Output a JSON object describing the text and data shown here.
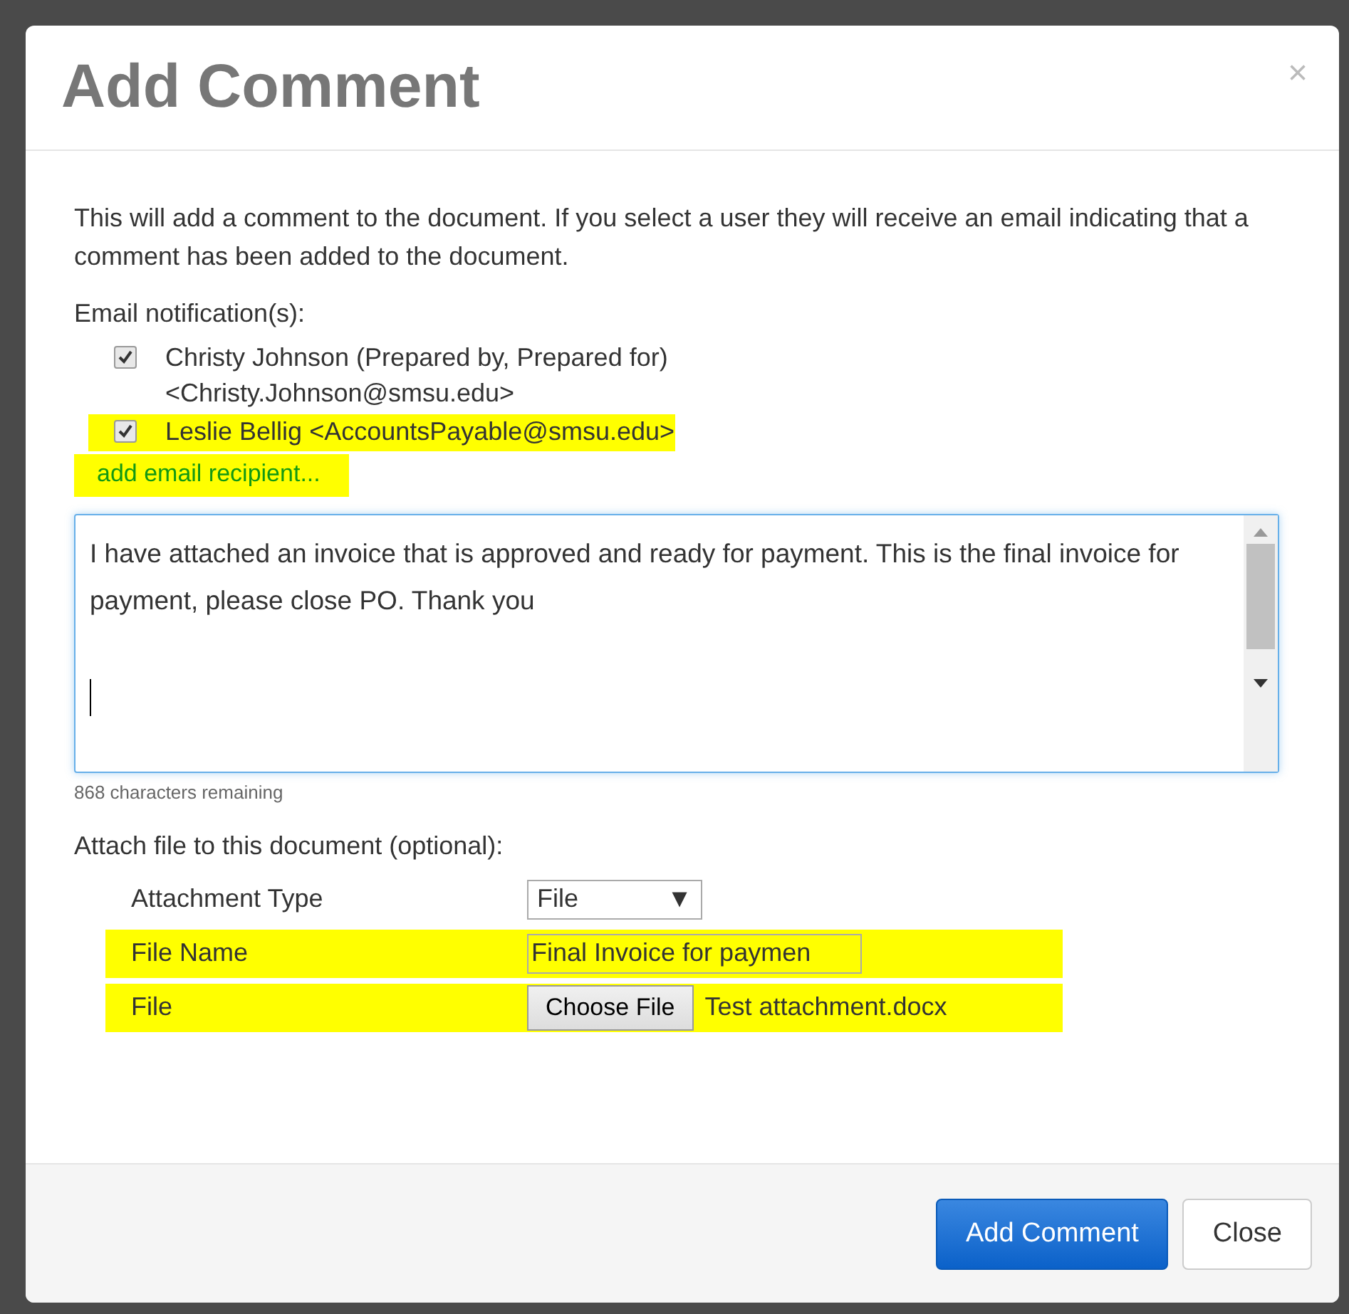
{
  "dialog": {
    "title": "Add Comment",
    "close": "×"
  },
  "intro": "This will add a comment to the document. If you select a user they will receive an email indicating that a comment has been added to the document.",
  "email_label": "Email notification(s):",
  "recipients": [
    {
      "name": "Christy Johnson (Prepared by, Prepared for)",
      "email": "<Christy.Johnson@smsu.edu>",
      "checked": true,
      "highlighted": false
    },
    {
      "name": "Leslie Bellig",
      "email": "<AccountsPayable@smsu.edu>",
      "checked": true,
      "highlighted": true
    }
  ],
  "add_recipient": {
    "label": "add email recipient...",
    "highlighted": true
  },
  "comment": {
    "value": "I have attached an invoice that is approved and ready for payment. This is the final invoice for payment, please close PO. Thank you\n\n",
    "counter": "868 characters remaining"
  },
  "attach_label": "Attach file to this document (optional):",
  "attachment_rows": [
    {
      "kind": "select",
      "label": "Attachment Type",
      "value": "File",
      "caret": "▼",
      "highlighted": false
    },
    {
      "kind": "text",
      "label": "File Name",
      "value": "Final Invoice for paymen",
      "highlighted": true
    },
    {
      "kind": "file",
      "label": "File",
      "button": "Choose File",
      "value": "Test attachment.docx",
      "highlighted": true
    }
  ],
  "buttons": [
    {
      "label": "Add Comment",
      "kind": "primary"
    },
    {
      "label": "Close",
      "kind": "default"
    }
  ]
}
